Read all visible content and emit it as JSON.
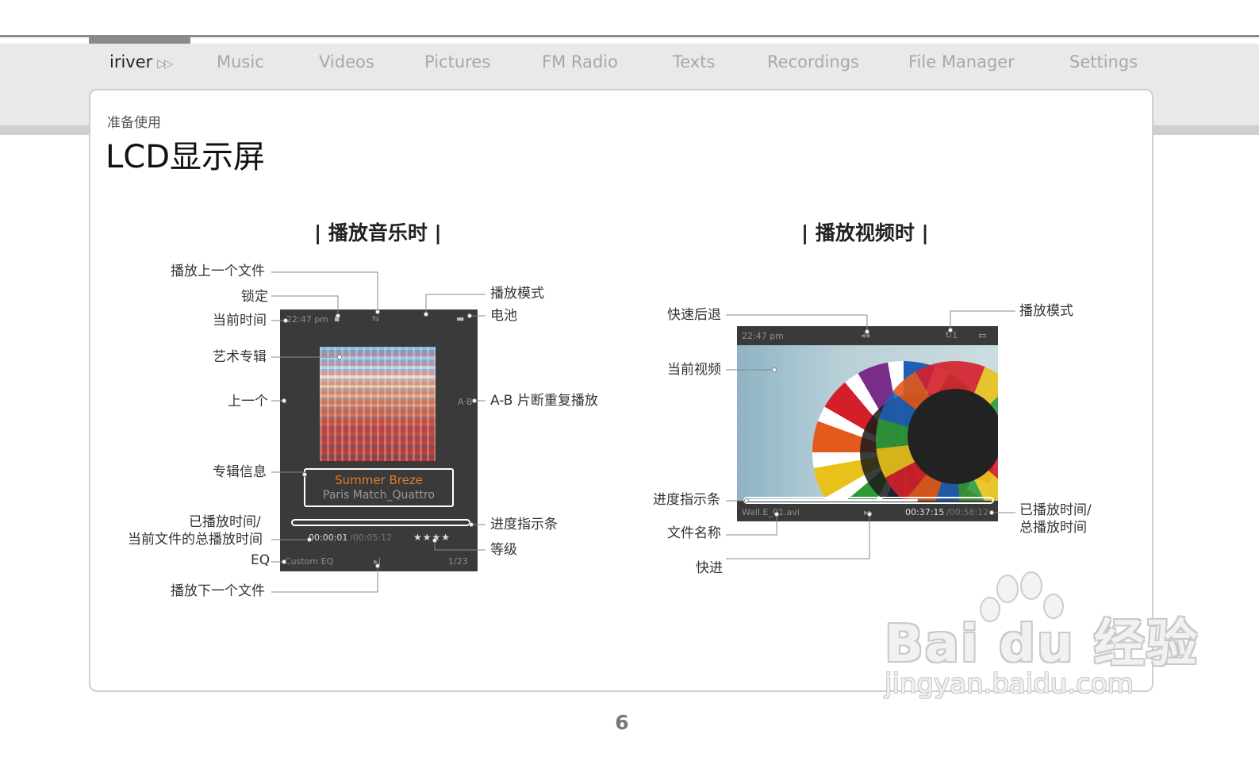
{
  "nav": {
    "brand": "iriver",
    "items": [
      "Music",
      "Videos",
      "Pictures",
      "FM Radio",
      "Texts",
      "Recordings",
      "File Manager",
      "Settings"
    ]
  },
  "page": {
    "section_label": "准备使用",
    "title": "LCD显示屏",
    "number": "6"
  },
  "music": {
    "heading": "| 播放音乐时 |",
    "labels": {
      "prev_file": "播放上一个文件",
      "lock": "锁定",
      "current_time": "当前时间",
      "album_art": "艺术专辑",
      "previous": "上一个",
      "album_info": "专辑信息",
      "elapsed_total_line1": "已播放时间/",
      "elapsed_total_line2": "当前文件的总播放时间",
      "eq": "EQ",
      "next_file": "播放下一个文件",
      "play_mode": "播放模式",
      "battery": "电池",
      "ab_repeat": "A-B 片断重复播放",
      "progress": "进度指示条",
      "rating": "等级"
    },
    "screen": {
      "time": "22:47 pm",
      "track_title": "Summer Breze",
      "artist_album": "Paris Match_Quattro",
      "elapsed": "00:00:01",
      "total": "/00:05:12",
      "stars": "★★★★",
      "eq": "Custom EQ",
      "index": "1/23"
    }
  },
  "video": {
    "heading": "| 播放视频时 |",
    "labels": {
      "rewind": "快速后退",
      "current_video": "当前视频",
      "progress": "进度指示条",
      "filename": "文件名称",
      "fast_forward": "快进",
      "play_mode": "播放模式",
      "elapsed_total_line1": "已播放时间/",
      "elapsed_total_line2": "总播放时间"
    },
    "screen": {
      "time": "22:47 pm",
      "filename": "Wall.E_01.avi",
      "elapsed": "00:37:15",
      "total": "/00:58:12",
      "progress_fraction": 0.7
    }
  },
  "watermark": {
    "text": "Bai du 经验",
    "sub": "jingyan.baidu.com"
  }
}
